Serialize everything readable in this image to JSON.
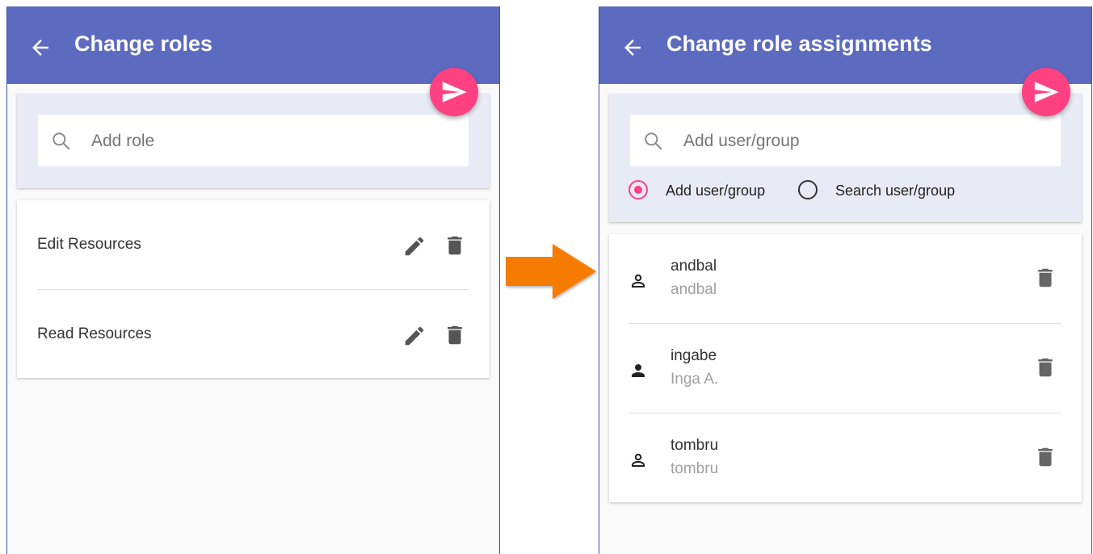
{
  "roles_panel": {
    "title": "Change roles",
    "search": {
      "placeholder": "Add role",
      "value": ""
    },
    "roles": [
      {
        "label": "Edit Resources"
      },
      {
        "label": "Read Resources"
      }
    ]
  },
  "assignments_panel": {
    "title": "Change role assignments",
    "search": {
      "placeholder": "Add user/group",
      "value": ""
    },
    "mode_options": [
      {
        "label": "Add user/group",
        "selected": true
      },
      {
        "label": "Search user/group",
        "selected": false
      }
    ],
    "assignments": [
      {
        "name": "andbal",
        "detail": "andbal",
        "icon": "person-outline-icon"
      },
      {
        "name": "ingabe",
        "detail": "Inga A.",
        "icon": "person-icon"
      },
      {
        "name": "tombru",
        "detail": "tombru",
        "icon": "person-outline-icon"
      }
    ]
  },
  "colors": {
    "app_bar": "#5c6bc0",
    "fab": "#ff4081",
    "radio_selected": "#ff4081",
    "search_card": "#e8eaf6",
    "transition_arrow": "#f57c00"
  }
}
